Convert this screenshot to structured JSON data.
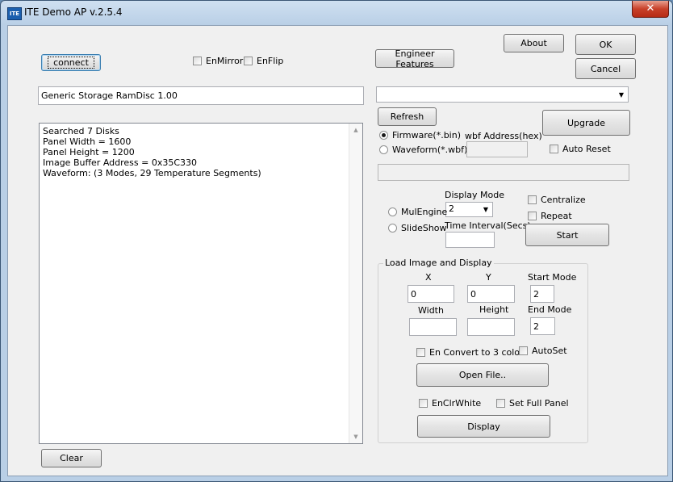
{
  "window": {
    "title": "ITE Demo AP v.2.5.4",
    "app_icon_text": "ITE",
    "close_glyph": "✕"
  },
  "buttons": {
    "connect": "connect",
    "engineer": "Engineer Features",
    "about": "About",
    "ok": "OK",
    "cancel": "Cancel",
    "refresh": "Refresh",
    "upgrade": "Upgrade",
    "start": "Start",
    "open_file": "Open File..",
    "display": "Display",
    "clear": "Clear"
  },
  "checkboxes": {
    "en_mirror": "EnMirror",
    "en_flip": "EnFlip",
    "auto_reset": "Auto Reset",
    "centralize": "Centralize",
    "repeat": "Repeat",
    "en_convert": "En Convert to 3 color",
    "auto_set": "AutoSet",
    "en_clr_white": "EnClrWhite",
    "set_full_panel": "Set Full Panel"
  },
  "device": {
    "name": "Generic Storage RamDisc 1.00"
  },
  "log": {
    "lines": [
      "Searched 7 Disks",
      "Panel Width = 1600",
      "Panel Height = 1200",
      "Image Buffer Address = 0x35C330",
      "Waveform: (3 Modes, 29 Temperature Segments)"
    ]
  },
  "upgrade": {
    "firmware_label": "Firmware(*.bin)",
    "waveform_label": "Waveform(*.wbf)",
    "wbf_address_label": "wbf Address(hex)",
    "selected": "firmware"
  },
  "display_mode": {
    "label": "Display Mode",
    "value": "2",
    "mulengine_label": "MulEngine",
    "slideshow_label": "SlideShow",
    "time_interval_label": "Time Interval(Secs)"
  },
  "load_image": {
    "group_title": "Load Image and Display",
    "x_label": "X",
    "x_value": "0",
    "y_label": "Y",
    "y_value": "0",
    "width_label": "Width",
    "height_label": "Height",
    "start_mode_label": "Start Mode",
    "start_mode_value": "2",
    "end_mode_label": "End Mode",
    "end_mode_value": "2"
  }
}
